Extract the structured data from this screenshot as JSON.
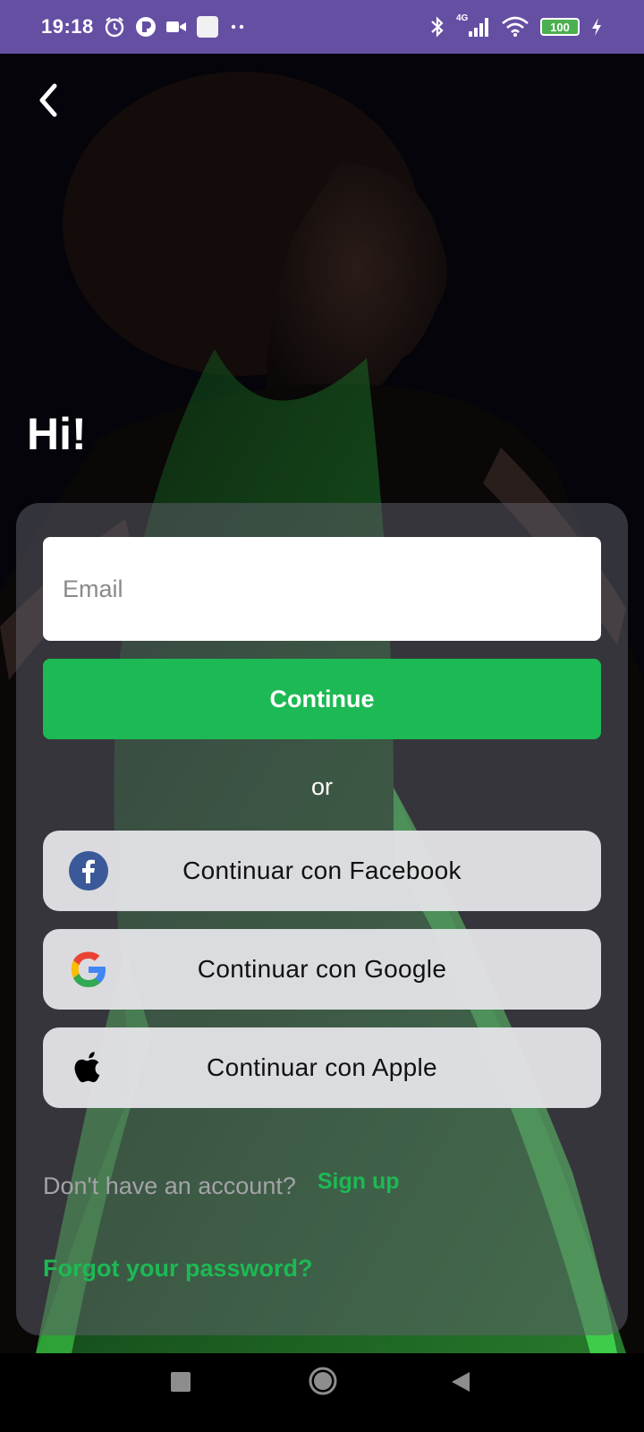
{
  "status_bar": {
    "time": "19:18",
    "network_label": "4G",
    "battery_level": "100",
    "background_color": "#654fa3",
    "icons": [
      "alarm-icon",
      "app-notification-icon",
      "video-camera-icon",
      "square-notification-icon",
      "more-dots-icon",
      "bluetooth-icon",
      "cellular-signal-icon",
      "wifi-icon",
      "battery-icon",
      "charging-icon"
    ]
  },
  "header": {
    "back_icon": "chevron-left-icon",
    "greeting": "Hi!"
  },
  "form": {
    "email_placeholder": "Email",
    "email_value": "",
    "continue_label": "Continue",
    "or_label": "or"
  },
  "social": {
    "facebook_label": "Continuar con Facebook",
    "google_label": "Continuar con Google",
    "apple_label": "Continuar con Apple"
  },
  "footer": {
    "signup_prompt": "Don't have an account?",
    "signup_link": "Sign up",
    "forgot_password": "Forgot your password?"
  },
  "navigation": {
    "recents_icon": "square-recents-icon",
    "home_icon": "circle-home-icon",
    "back_icon": "triangle-back-icon"
  },
  "colors": {
    "accent": "#1db954",
    "card_background": "rgba(95,95,108,0.52)",
    "social_button": "#e2e2e6",
    "facebook_blue": "#3b5998"
  }
}
